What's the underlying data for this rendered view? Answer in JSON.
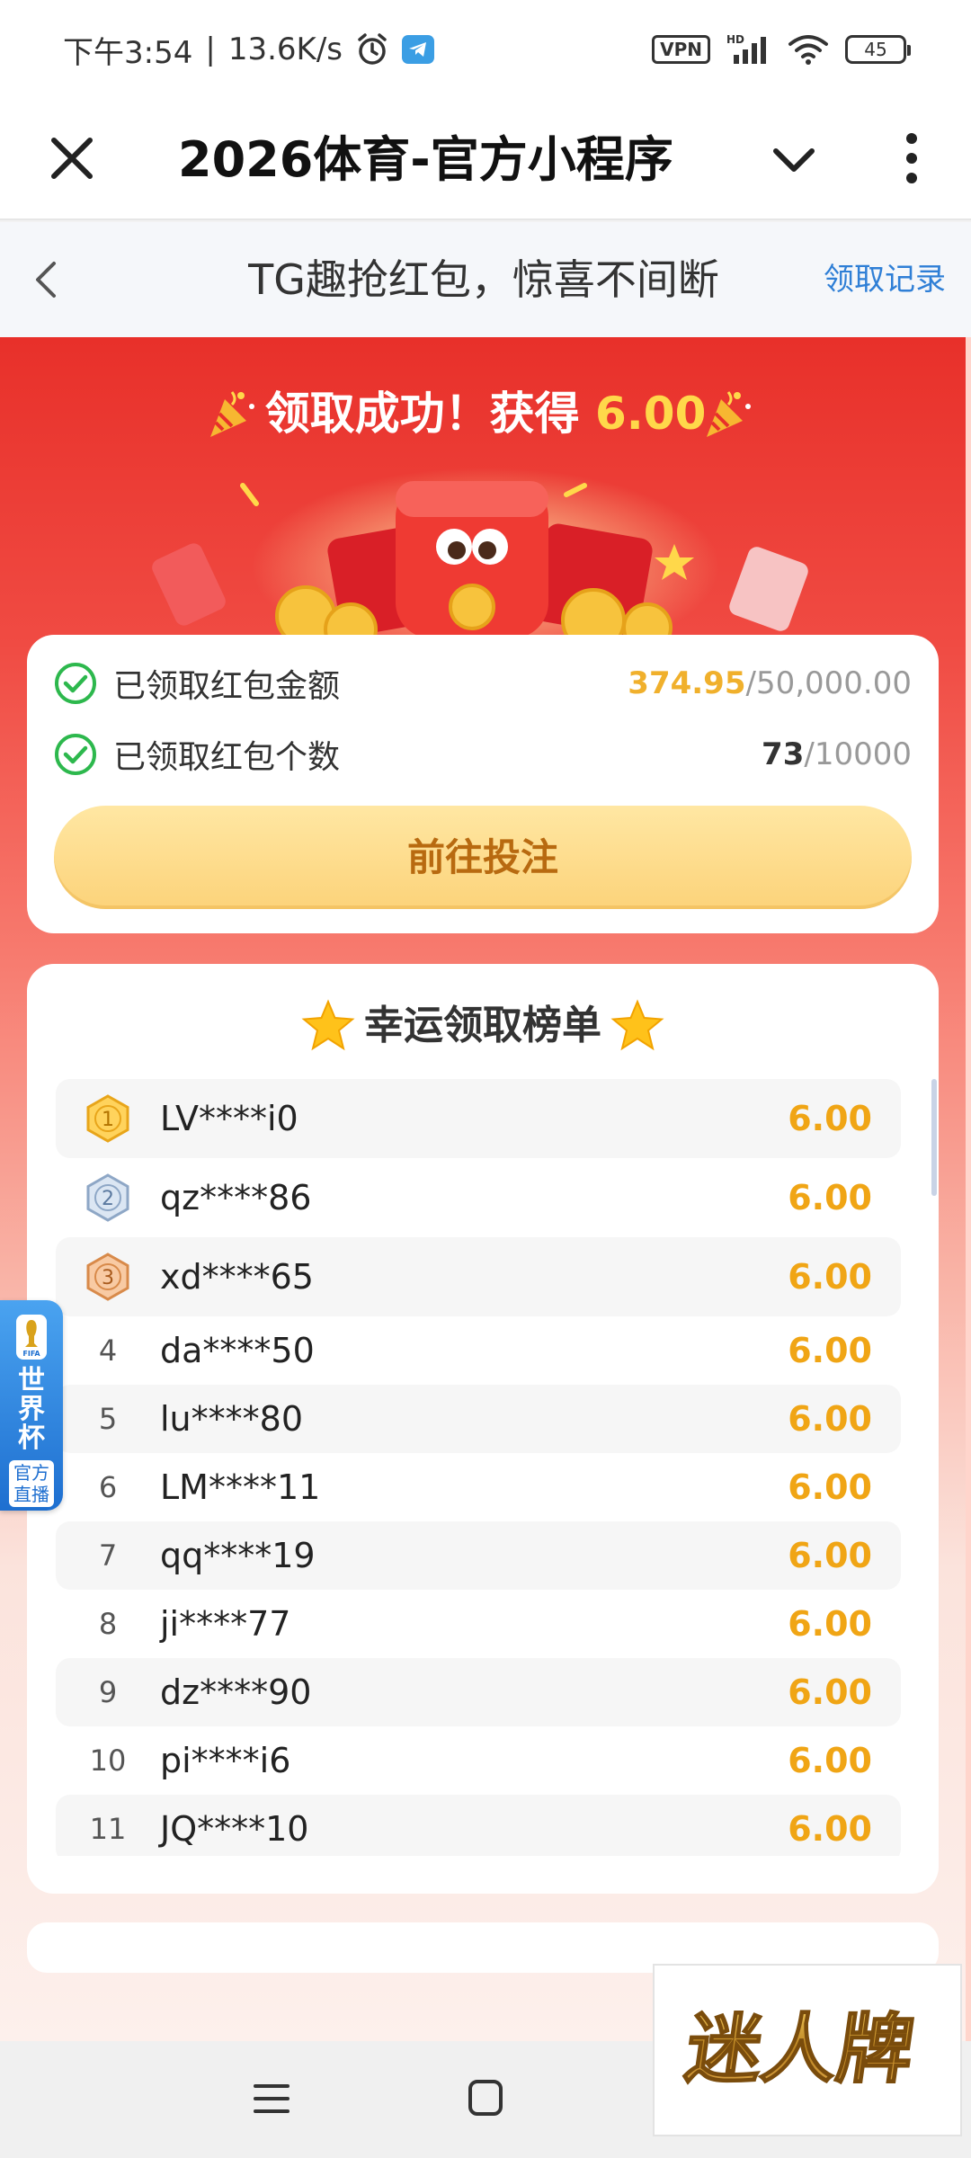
{
  "status_bar": {
    "time": "下午3:54",
    "speed": "13.6K/s",
    "vpn": "VPN",
    "battery": "45"
  },
  "mini_program": {
    "title": "2026体育-官方小程序"
  },
  "header": {
    "title": "TG趣抢红包，惊喜不间断",
    "record_link": "领取记录"
  },
  "hero": {
    "success_prefix": "领取成功！获得",
    "success_amount": "6.00"
  },
  "stats": {
    "amount_label": "已领取红包金额",
    "amount_current": "374.95",
    "amount_total": "/50,000.00",
    "count_label": "已领取红包个数",
    "count_current": "73",
    "count_total": "/10000",
    "bet_button": "前往投注"
  },
  "leaderboard": {
    "title": "幸运领取榜单",
    "rows": [
      {
        "rank": "1",
        "name": "LV****i0",
        "amount": "6.00"
      },
      {
        "rank": "2",
        "name": "qz****86",
        "amount": "6.00"
      },
      {
        "rank": "3",
        "name": "xd****65",
        "amount": "6.00"
      },
      {
        "rank": "4",
        "name": "da****50",
        "amount": "6.00"
      },
      {
        "rank": "5",
        "name": "lu****80",
        "amount": "6.00"
      },
      {
        "rank": "6",
        "name": "LM****11",
        "amount": "6.00"
      },
      {
        "rank": "7",
        "name": "qq****19",
        "amount": "6.00"
      },
      {
        "rank": "8",
        "name": "ji****77",
        "amount": "6.00"
      },
      {
        "rank": "9",
        "name": "dz****90",
        "amount": "6.00"
      },
      {
        "rank": "10",
        "name": "pi****i6",
        "amount": "6.00"
      },
      {
        "rank": "11",
        "name": "JQ****10",
        "amount": "6.00"
      }
    ]
  },
  "float_widget": {
    "fifa": "FIFA",
    "title": "世界杯",
    "subtitle": "官方直播"
  },
  "watermark": {
    "text": "迷人牌"
  },
  "colors": {
    "accent_red": "#e8302a",
    "gold": "#f0a515",
    "link_blue": "#2f7fd6",
    "check_green": "#2db84d"
  }
}
